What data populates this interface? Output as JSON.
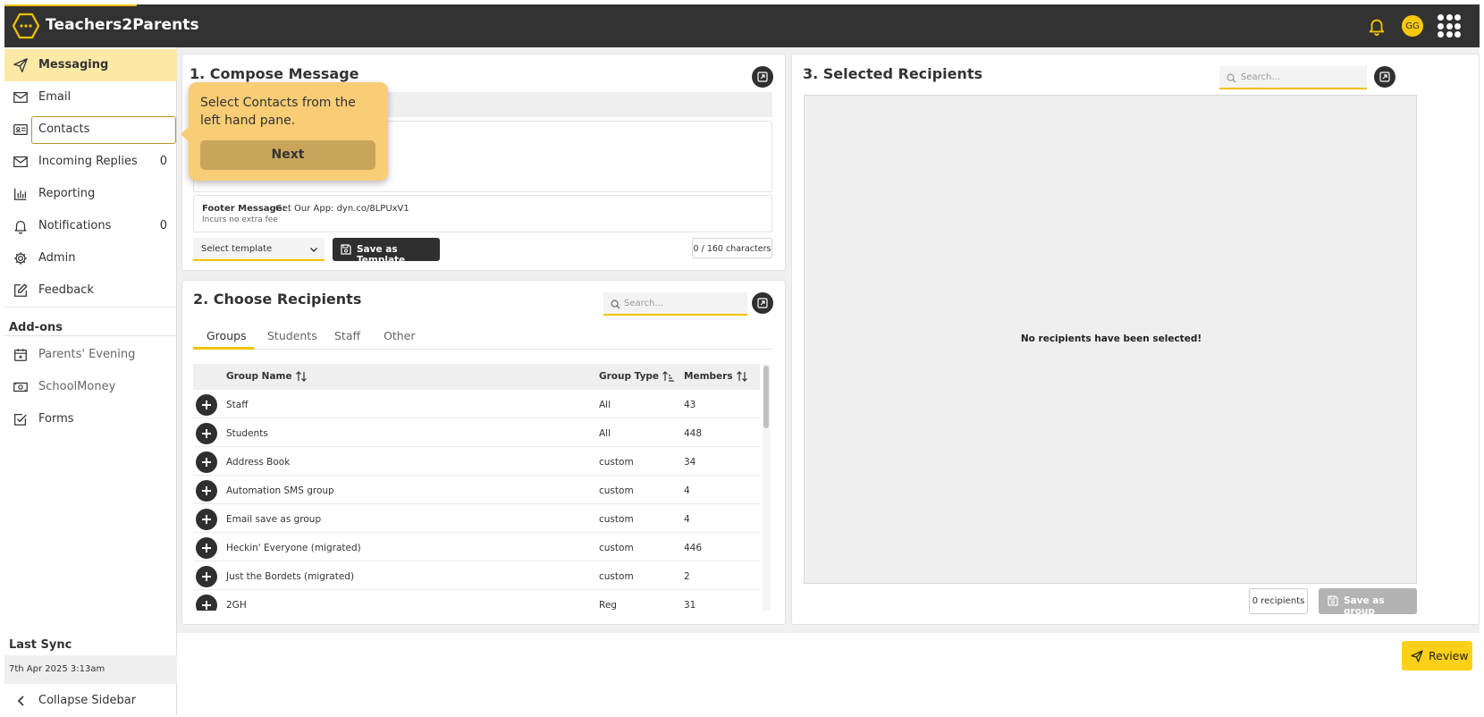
{
  "app": {
    "name": "Teachers2Parents",
    "avatar_initials": "GG",
    "accent": "#f2c200"
  },
  "sidebar": {
    "items": [
      {
        "label": "Messaging",
        "icon": "send-icon",
        "count": ""
      },
      {
        "label": "Email",
        "icon": "mail-icon",
        "count": ""
      },
      {
        "label": "Contacts",
        "icon": "contact-card-icon",
        "count": ""
      },
      {
        "label": "Incoming Replies",
        "icon": "mail-icon",
        "count": "0"
      },
      {
        "label": "Reporting",
        "icon": "bar-chart-icon",
        "count": ""
      },
      {
        "label": "Notifications",
        "icon": "bell-icon",
        "count": "0"
      },
      {
        "label": "Admin",
        "icon": "gear-icon",
        "count": ""
      },
      {
        "label": "Feedback",
        "icon": "edit-icon",
        "count": ""
      }
    ],
    "addons_title": "Add-ons",
    "addons": [
      {
        "label": "Parents' Evening",
        "icon": "calendar-icon"
      },
      {
        "label": "SchoolMoney",
        "icon": "money-icon"
      },
      {
        "label": "Forms",
        "icon": "checkbox-icon"
      }
    ],
    "last_sync_title": "Last Sync",
    "last_sync_value": "7th Apr 2025 3:13am",
    "collapse_label": "Collapse Sidebar"
  },
  "compose": {
    "title": "1. Compose Message",
    "footer_label": "Footer Message:",
    "footer_value": "Get Our App: dyn.co/8LPUxV1",
    "footer_note": "Incurs no extra fee",
    "template_select": "Select template",
    "save_template": "Save as Template",
    "char_count": "0 / 160 characters"
  },
  "recipients": {
    "title": "2. Choose Recipients",
    "search_placeholder": "Search...",
    "tabs": [
      "Groups",
      "Students",
      "Staff",
      "Other"
    ],
    "columns": [
      "Group Name",
      "Group Type",
      "Members"
    ],
    "rows": [
      {
        "name": "Staff",
        "type": "All",
        "members": "43"
      },
      {
        "name": "Students",
        "type": "All",
        "members": "448"
      },
      {
        "name": "Address Book",
        "type": "custom",
        "members": "34"
      },
      {
        "name": "Automation SMS group",
        "type": "custom",
        "members": "4"
      },
      {
        "name": "Email save as group",
        "type": "custom",
        "members": "4"
      },
      {
        "name": "Heckin' Everyone (migrated)",
        "type": "custom",
        "members": "446"
      },
      {
        "name": "Just the Bordets (migrated)",
        "type": "custom",
        "members": "2"
      },
      {
        "name": "2GH",
        "type": "Reg",
        "members": "31"
      }
    ]
  },
  "selected": {
    "title": "3. Selected Recipients",
    "search_placeholder": "Search...",
    "empty_text": "No recipients have been selected!",
    "count": "0 recipients",
    "save_group": "Save as group"
  },
  "review": {
    "label": "Review"
  },
  "tooltip": {
    "text": "Select Contacts from the left hand pane.",
    "next": "Next"
  }
}
